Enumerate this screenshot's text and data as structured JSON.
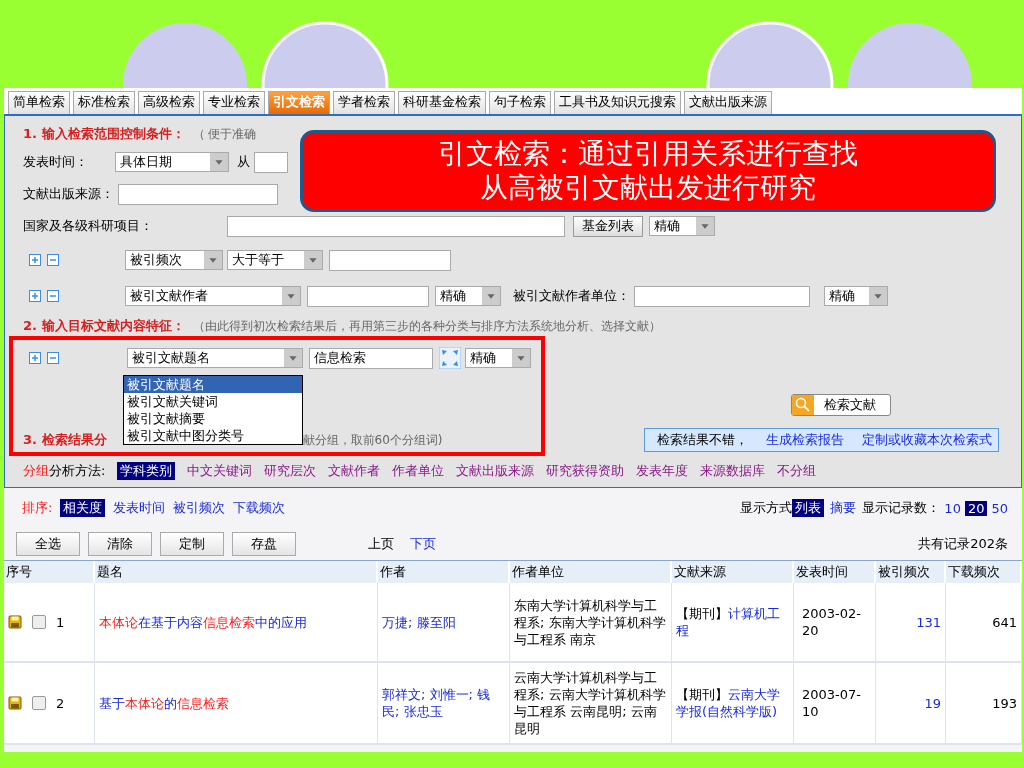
{
  "tabs": [
    {
      "label": "简单检索",
      "selected": false
    },
    {
      "label": "标准检索",
      "selected": false
    },
    {
      "label": "高级检索",
      "selected": false
    },
    {
      "label": "专业检索",
      "selected": false
    },
    {
      "label": "引文检索",
      "selected": true
    },
    {
      "label": "学者检索",
      "selected": false
    },
    {
      "label": "科研基金检索",
      "selected": false
    },
    {
      "label": "句子检索",
      "selected": false
    },
    {
      "label": "工具书及知识元搜索",
      "selected": false
    },
    {
      "label": "文献出版来源",
      "selected": false
    }
  ],
  "callout": {
    "lines": [
      "引文检索：通过引用关系进行查找",
      "从高被引文献出发进行研究"
    ]
  },
  "section1": {
    "title": "1. 输入检索范围控制条件：",
    "note": "（ 便于准确"
  },
  "date_row": {
    "label": "发表时间：",
    "select": "具体日期",
    "from_label": "从"
  },
  "source_row": {
    "label": "文献出版来源："
  },
  "project_row": {
    "label": "国家及各级科研项目：",
    "button": "基金列表",
    "match": "精确"
  },
  "citation_row": {
    "field": "被引频次",
    "operator": "大于等于"
  },
  "author_row": {
    "field": "被引文献作者",
    "match": "精确",
    "affiliation_label": "被引文献作者单位：",
    "affiliation_match": "精确"
  },
  "section2": {
    "title": "2. 输入目标文献内容特征：",
    "note": "（由此得到初次检索结果后，再用第三步的各种分类与排序方法系统地分析、选择文献）"
  },
  "content_row": {
    "field": "被引文献题名",
    "value": "信息检索",
    "match": "精确",
    "options": [
      {
        "label": "被引文献题名",
        "selected": true
      },
      {
        "label": "被引文献关键词",
        "selected": false
      },
      {
        "label": "被引文献摘要",
        "selected": false
      },
      {
        "label": "被引文献中图分类号",
        "selected": false
      }
    ]
  },
  "search_button": "检索文献",
  "section3": {
    "title": "3. 检索结果分",
    "note": "献分组，取前60个分组词)"
  },
  "report_bar": {
    "text": "检索结果不错，",
    "links": [
      "生成检索报告",
      "定制或收藏本次检索式"
    ]
  },
  "grouping": {
    "highlight": "分组",
    "label": "分析方法:",
    "methods": [
      {
        "label": "学科类别",
        "selected": true
      },
      {
        "label": "中文关键词",
        "selected": false
      },
      {
        "label": "研究层次",
        "selected": false
      },
      {
        "label": "文献作者",
        "selected": false
      },
      {
        "label": "作者单位",
        "selected": false
      },
      {
        "label": "文献出版来源",
        "selected": false
      },
      {
        "label": "研究获得资助",
        "selected": false
      },
      {
        "label": "发表年度",
        "selected": false
      },
      {
        "label": "来源数据库",
        "selected": false
      },
      {
        "label": "不分组",
        "selected": false
      }
    ]
  },
  "sort": {
    "label": "排序:",
    "options": [
      {
        "label": "相关度",
        "selected": true
      },
      {
        "label": "发表时间",
        "selected": false
      },
      {
        "label": "被引频次",
        "selected": false
      },
      {
        "label": "下载频次",
        "selected": false
      }
    ]
  },
  "display": {
    "label": "显示方式",
    "modes": [
      {
        "label": "列表",
        "selected": true
      },
      {
        "label": "摘要",
        "selected": false
      }
    ],
    "count_label": "显示记录数：",
    "counts": [
      {
        "label": "10",
        "selected": false
      },
      {
        "label": "20",
        "selected": true
      },
      {
        "label": "50",
        "selected": false
      }
    ]
  },
  "actions": [
    "全选",
    "清除",
    "定制",
    "存盘"
  ],
  "pager": [
    {
      "label": "上页",
      "disabled": true
    },
    {
      "label": "下页",
      "disabled": false
    }
  ],
  "total": "共有记录202条",
  "table": {
    "columns": [
      "序号",
      "题名",
      "作者",
      "作者单位",
      "文献来源",
      "发表时间",
      "被引频次",
      "下载频次"
    ],
    "rows": [
      {
        "index": "1",
        "checked": false,
        "title": [
          {
            "text": "本体论",
            "hit": true
          },
          {
            "text": "在基于内容",
            "hit": false
          },
          {
            "text": "信息检索",
            "hit": true
          },
          {
            "text": "中的应用",
            "hit": false
          }
        ],
        "authors": "万捷; 滕至阳",
        "affiliation": "东南大学计算机科学与工程系; 东南大学计算机科学与工程系  南京",
        "source_type": "【期刊】",
        "source": "计算机工程",
        "date": "2003-02-20",
        "cited": "131",
        "downloads": "641"
      },
      {
        "index": "2",
        "checked": false,
        "title": [
          {
            "text": "基于",
            "hit": false
          },
          {
            "text": "本体论",
            "hit": true
          },
          {
            "text": "的",
            "hit": false
          },
          {
            "text": "信息检索",
            "hit": true
          }
        ],
        "authors": "郭祥文; 刘惟一; 钱民; 张忠玉",
        "affiliation": "云南大学计算机科学与工程系; 云南大学计算机科学与工程系  云南昆明; 云南昆明",
        "source_type": "【期刊】",
        "source": "云南大学学报(自然科学版)",
        "date": "2003-07-10",
        "cited": "19",
        "downloads": "193"
      }
    ]
  }
}
